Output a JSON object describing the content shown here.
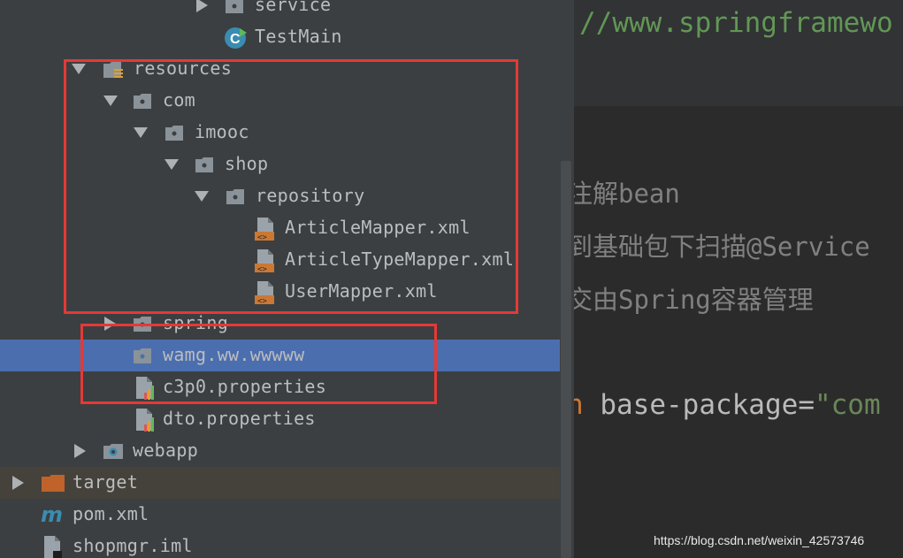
{
  "tree": {
    "items": [
      {
        "label": "service",
        "icon": "package-folder-icon",
        "arrow": "closed"
      },
      {
        "label": "TestMain",
        "icon": "java-class-icon",
        "arrow": "none"
      },
      {
        "label": "resources",
        "icon": "resources-folder-icon",
        "arrow": "open"
      },
      {
        "label": "com",
        "icon": "package-folder-icon",
        "arrow": "open"
      },
      {
        "label": "imooc",
        "icon": "package-folder-icon",
        "arrow": "open"
      },
      {
        "label": "shop",
        "icon": "package-folder-icon",
        "arrow": "open"
      },
      {
        "label": "repository",
        "icon": "package-folder-icon",
        "arrow": "open"
      },
      {
        "label": "ArticleMapper.xml",
        "icon": "xml-file-icon",
        "arrow": "none"
      },
      {
        "label": "ArticleTypeMapper.xml",
        "icon": "xml-file-icon",
        "arrow": "none"
      },
      {
        "label": "UserMapper.xml",
        "icon": "xml-file-icon",
        "arrow": "none"
      },
      {
        "label": "spring",
        "icon": "package-folder-icon",
        "arrow": "closed"
      },
      {
        "label": "wamg.ww.wwwww",
        "icon": "package-folder-icon",
        "arrow": "none",
        "selected": true
      },
      {
        "label": "c3p0.properties",
        "icon": "properties-file-icon",
        "arrow": "none"
      },
      {
        "label": "dto.properties",
        "icon": "properties-file-icon",
        "arrow": "none"
      },
      {
        "label": "webapp",
        "icon": "web-folder-icon",
        "arrow": "closed"
      },
      {
        "label": "target",
        "icon": "excluded-folder-icon",
        "arrow": "closed"
      },
      {
        "label": "pom.xml",
        "icon": "maven-icon",
        "arrow": "none"
      },
      {
        "label": "shopmgr.iml",
        "icon": "iml-file-icon",
        "arrow": "none"
      }
    ]
  },
  "editor": {
    "lines": [
      {
        "text": "//www.springframewo",
        "color": "#629755"
      },
      {
        "text": "注解bean",
        "color": "#808080"
      },
      {
        "text": "到基础包下扫描@Service",
        "color": "#808080"
      },
      {
        "text": "交由Spring容器管理",
        "color": "#808080"
      }
    ],
    "attr_prefix": "n",
    "attr_name": " base-package",
    "attr_eq": "=",
    "attr_value": "\"com"
  },
  "watermark": "https://blog.csdn.net/weixin_42573746",
  "colors": {
    "selection": "#4b6eaf",
    "highlight_box": "#e53935",
    "tree_bg": "#3c3f41",
    "editor_bg": "#2b2b2b"
  }
}
